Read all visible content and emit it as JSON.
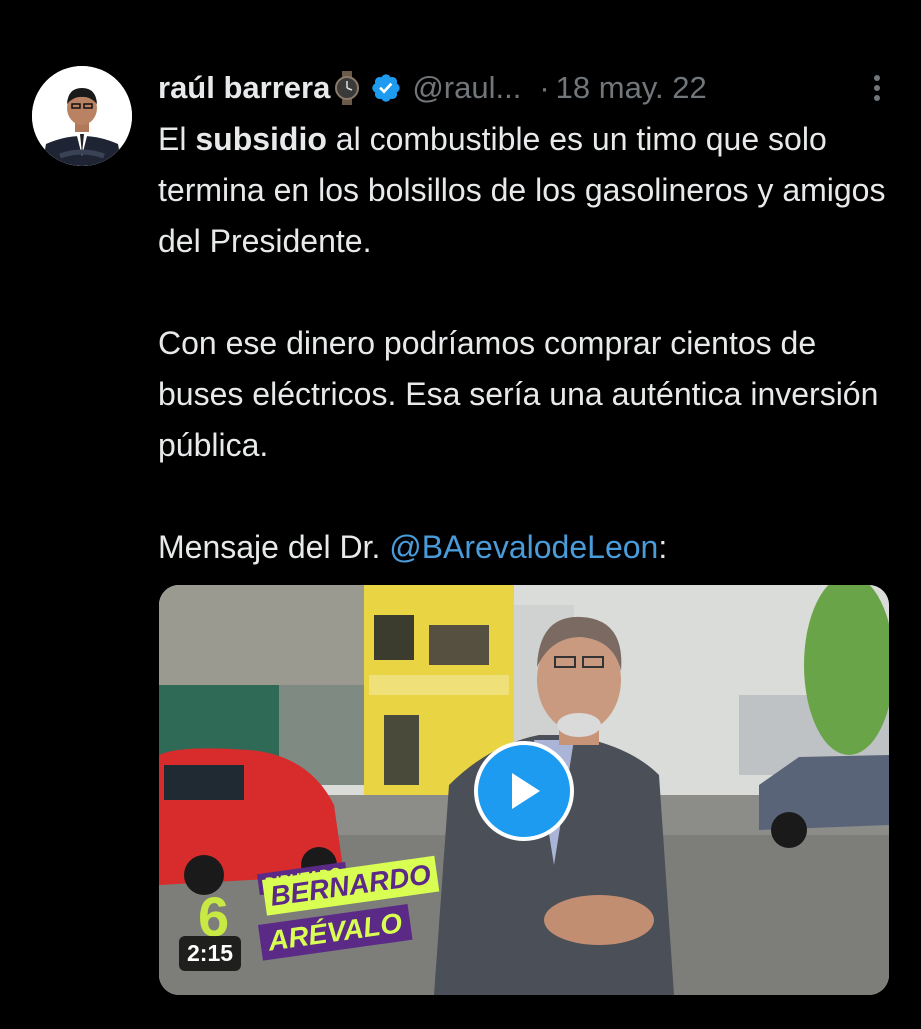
{
  "tweet": {
    "author_name": "raúl barrera",
    "author_handle": "@raul...",
    "date": "18 may. 22",
    "separator": "·",
    "icons": {
      "name_emoji": "watch-icon",
      "badge": "verified-icon",
      "menu": "more-vertical-icon"
    },
    "text": {
      "p1_a": "El ",
      "p1_bold": "subsidio",
      "p1_b": " al combustible es un timo que solo termina en los bolsillos de los gasolineros y amigos del Presidente.",
      "p2": "Con ese dinero podríamos comprar cientos de buses eléctricos. Esa sería una auténtica inversión pública.",
      "p3_a": "Mensaje del Dr. ",
      "p3_mention": "@BArevalodeLeon",
      "p3_b": ":"
    },
    "video": {
      "duration": "2:15",
      "overlay_small": "DIPUTADO",
      "overlay_first": "BERNARDO",
      "overlay_last": "ARÉVALO",
      "overlay_number": "6"
    },
    "colors": {
      "background": "#000000",
      "text": "#e7e9ea",
      "secondary": "#71767b",
      "link": "#4a9bd9",
      "verified": "#1d9bf0"
    }
  }
}
